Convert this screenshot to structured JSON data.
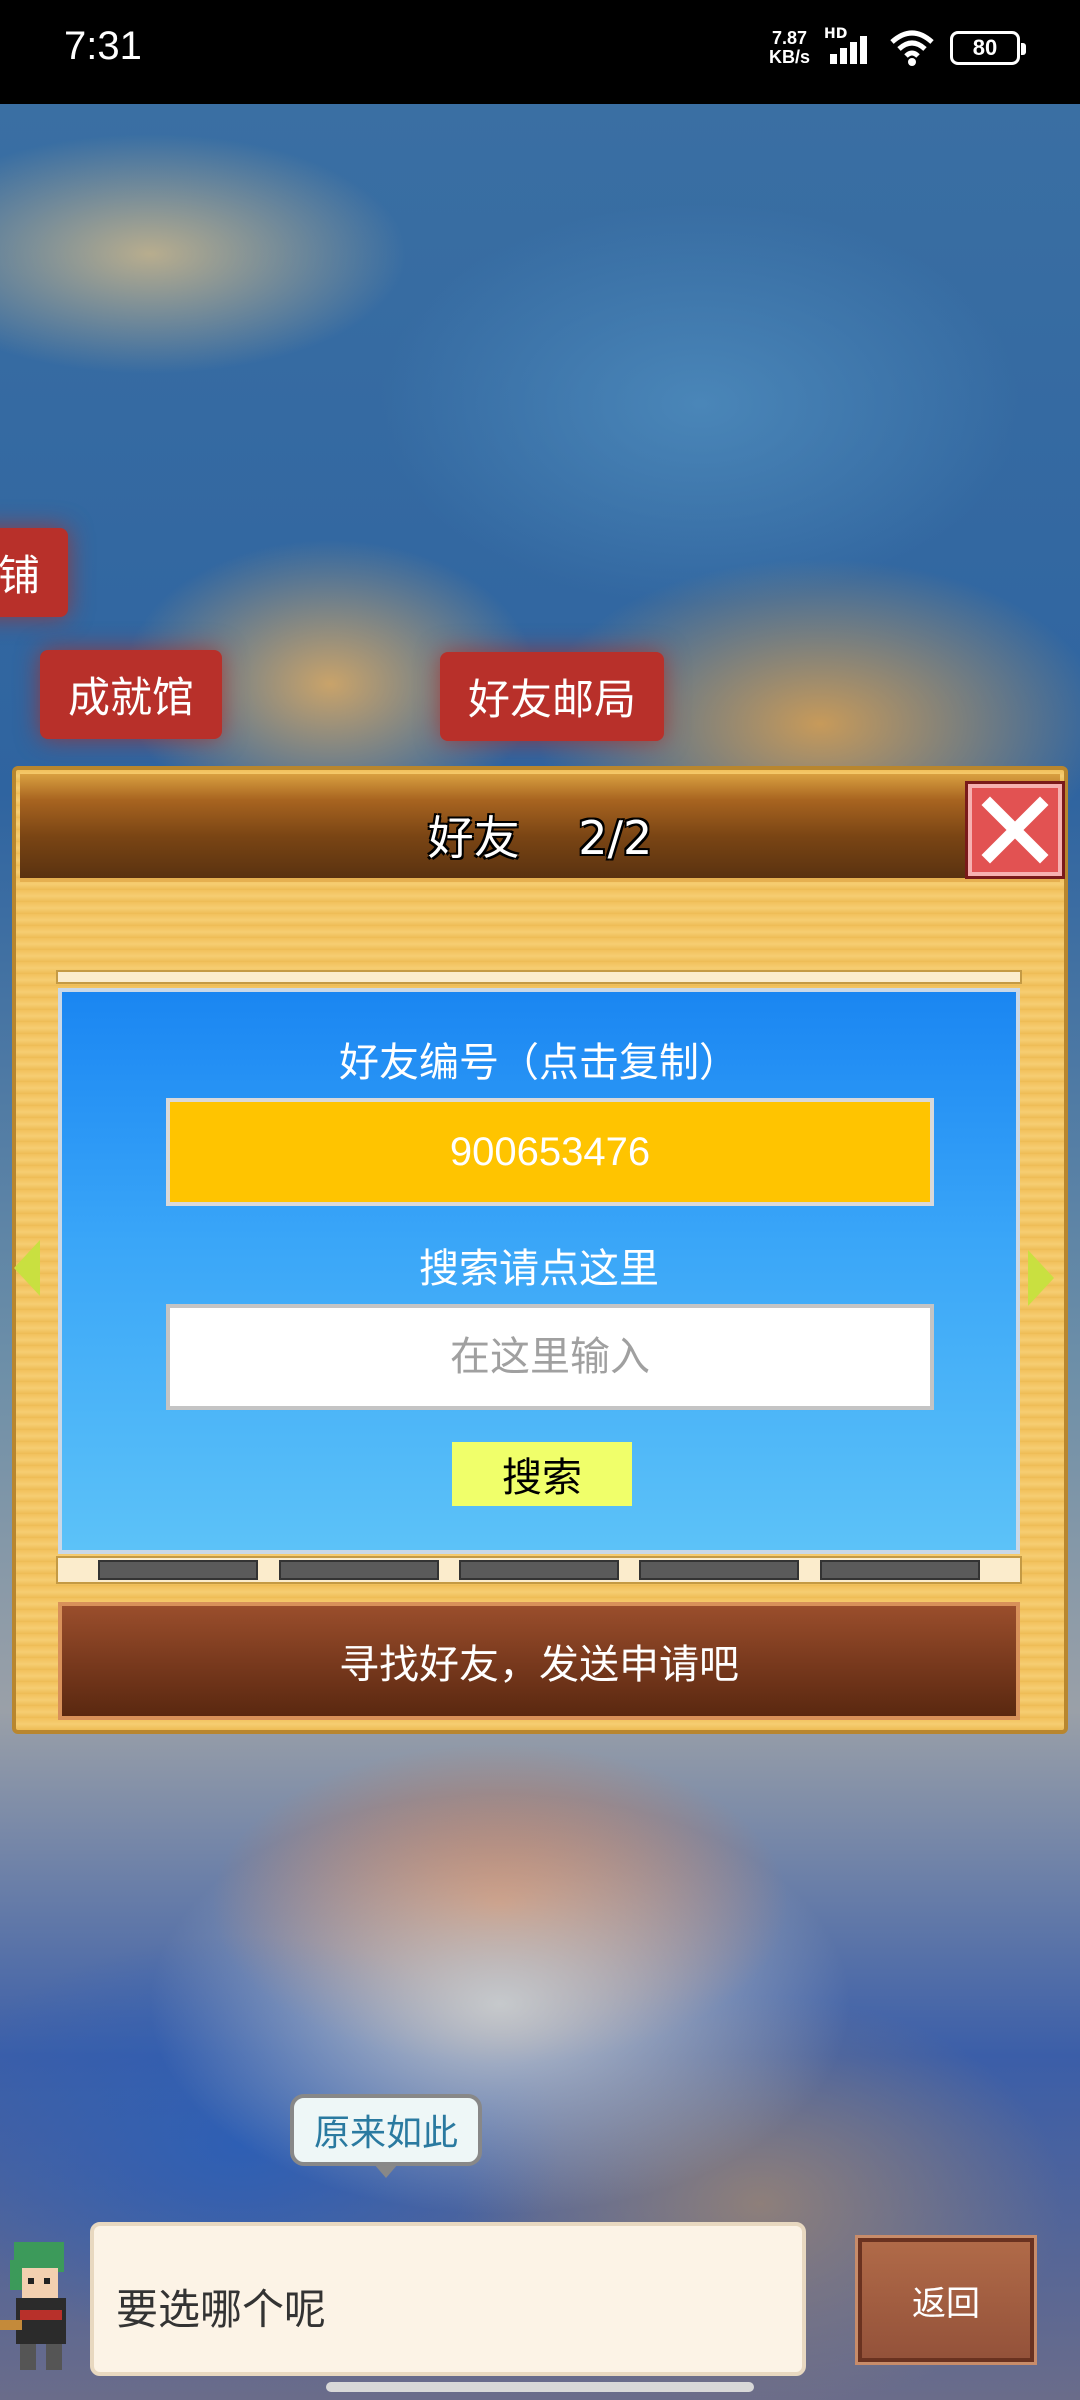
{
  "status_bar": {
    "time": "7:31",
    "net_speed_value": "7.87",
    "net_speed_unit": "KB/s",
    "signal_label": "HD",
    "battery": "80"
  },
  "background": {
    "partial_label": "铺",
    "achievement_hall": "成就馆",
    "friend_post_office": "好友邮局"
  },
  "dialog": {
    "title": "好友    2/2",
    "friend_id_label": "好友编号（点击复制）",
    "friend_id": "900653476",
    "search_label": "搜索请点这里",
    "search_placeholder": "在这里输入",
    "search_button": "搜索",
    "hint": "寻找好友，发送申请吧"
  },
  "speech_bubble": "原来如此",
  "dialogue": {
    "text": "要选哪个呢",
    "back_button": "返回"
  }
}
